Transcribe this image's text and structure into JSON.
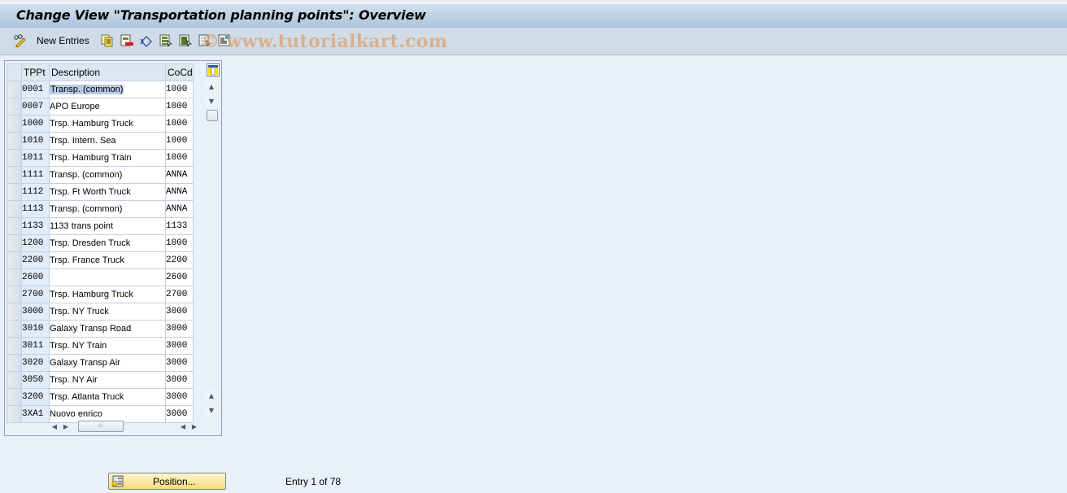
{
  "window": {
    "title": "Change View \"Transportation planning points\": Overview"
  },
  "toolbar": {
    "items": [
      {
        "icon": "display-change-icon",
        "label": ""
      },
      {
        "icon": "new-entries-icon",
        "label": "New Entries"
      },
      {
        "icon": "copy-as-icon",
        "label": ""
      },
      {
        "icon": "delete-icon",
        "label": ""
      },
      {
        "icon": "undo-change-icon",
        "label": ""
      },
      {
        "icon": "select-all-icon",
        "label": ""
      },
      {
        "icon": "select-block-icon",
        "label": ""
      },
      {
        "icon": "deselect-all-icon",
        "label": ""
      },
      {
        "icon": "print-field-list-icon",
        "label": ""
      }
    ],
    "new_entries_label": "New Entries"
  },
  "watermark": "© www.tutorialkart.com",
  "table": {
    "columns": [
      "TPPt",
      "Description",
      "CoCd"
    ],
    "rows": [
      {
        "tppt": "0001",
        "description": "Transp. (common)",
        "cocd": "1000",
        "selected_text": true
      },
      {
        "tppt": "0007",
        "description": "APO Europe",
        "cocd": "1000"
      },
      {
        "tppt": "1000",
        "description": "Trsp. Hamburg Truck",
        "cocd": "1000"
      },
      {
        "tppt": "1010",
        "description": "Trsp. Intern. Sea",
        "cocd": "1000"
      },
      {
        "tppt": "1011",
        "description": "Trsp. Hamburg Train",
        "cocd": "1000"
      },
      {
        "tppt": "1111",
        "description": "Transp. (common)",
        "cocd": "ANNA"
      },
      {
        "tppt": "1112",
        "description": "Trsp. Ft Worth Truck",
        "cocd": "ANNA"
      },
      {
        "tppt": "1113",
        "description": "Transp. (common)",
        "cocd": "ANNA"
      },
      {
        "tppt": "1133",
        "description": "1133 trans point",
        "cocd": "1133"
      },
      {
        "tppt": "1200",
        "description": "Trsp. Dresden Truck",
        "cocd": "1000"
      },
      {
        "tppt": "2200",
        "description": "Trsp. France Truck",
        "cocd": "2200"
      },
      {
        "tppt": "2600",
        "description": "",
        "cocd": "2600"
      },
      {
        "tppt": "2700",
        "description": "Trsp. Hamburg Truck",
        "cocd": "2700"
      },
      {
        "tppt": "3000",
        "description": "Trsp. NY Truck",
        "cocd": "3000"
      },
      {
        "tppt": "3010",
        "description": "Galaxy Transp Road",
        "cocd": "3000"
      },
      {
        "tppt": "3011",
        "description": "Trsp. NY Train",
        "cocd": "3000"
      },
      {
        "tppt": "3020",
        "description": "Galaxy Transp Air",
        "cocd": "3000"
      },
      {
        "tppt": "3050",
        "description": "Trsp. NY Air",
        "cocd": "3000"
      },
      {
        "tppt": "3200",
        "description": "Trsp. Atlanta Truck",
        "cocd": "3000"
      },
      {
        "tppt": "3XA1",
        "description": "Nuovo enrico",
        "cocd": "3000"
      }
    ]
  },
  "footer": {
    "position_button_label": "Position...",
    "entry_text": "Entry 1 of 78"
  },
  "colors": {
    "title_gradient_top": "#d3e0ee",
    "title_gradient_bottom": "#adc4dc",
    "toolbar_bg": "#cfdce7",
    "body_bg": "#e9f0f8",
    "key_column_bg": "#e0ecf7",
    "button_yellow": "#f6dc7c"
  }
}
